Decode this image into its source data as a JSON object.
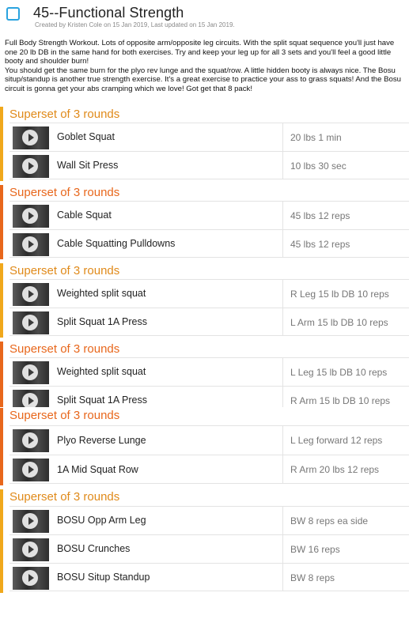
{
  "header": {
    "title": "45--Functional Strength",
    "meta": "Created by Kristen Cole on 15 Jan 2019, Last updated on 15 Jan 2019."
  },
  "description": [
    "Full Body Strength Workout. Lots of opposite arm/opposite leg circuits. With the split squat sequence you'll just have one 20 lb DB in the same hand for both exercises. Try and keep your leg up for all 3 sets and you'll feel a good little booty and shoulder burn!",
    "You should get the same burn for the plyo rev lunge and the squat/row. A little hidden booty is always nice. The Bosu situp/standup is another true strength exercise. It's a great exercise to practice your ass to grass squats! And the Bosu circuit is gonna get your abs cramping which we love! Got get that 8 pack!"
  ],
  "colors": {
    "accent_orange": "#e8671c",
    "accent_yellow": "#f0a81c",
    "checkbox_blue": "#2aa3df"
  },
  "sections": [
    {
      "title": "Superset of 3 rounds",
      "exercises": [
        {
          "name": "Goblet Squat",
          "detail": "20 lbs 1 min"
        },
        {
          "name": "Wall Sit Press",
          "detail": "10 lbs 30 sec"
        }
      ]
    },
    {
      "title": "Superset of 3 rounds",
      "exercises": [
        {
          "name": "Cable Squat",
          "detail": "45 lbs 12 reps"
        },
        {
          "name": "Cable Squatting Pulldowns",
          "detail": "45 lbs 12 reps"
        }
      ]
    },
    {
      "title": "Superset of 3 rounds",
      "exercises": [
        {
          "name": "Weighted split squat",
          "detail": "R Leg 15 lb DB 10 reps"
        },
        {
          "name": "Split Squat 1A Press",
          "detail": "L Arm 15 lb DB 10 reps"
        }
      ]
    },
    {
      "title": "Superset of 3 rounds",
      "exercises": [
        {
          "name": "Weighted split squat",
          "detail": "L Leg 15 lb DB 10 reps"
        },
        {
          "name": "Split Squat 1A Press",
          "detail": "R Arm 15 lb DB 10 reps"
        }
      ]
    },
    {
      "title": "Superset of 3 rounds",
      "exercises": [
        {
          "name": "Plyo Reverse Lunge",
          "detail": "L Leg forward 12 reps"
        },
        {
          "name": "1A Mid Squat Row",
          "detail": "R Arm 20 lbs 12 reps"
        }
      ]
    },
    {
      "title": "Superset of 3 rounds",
      "exercises": [
        {
          "name": "BOSU Opp Arm Leg",
          "detail": "BW 8 reps ea side"
        },
        {
          "name": "BOSU Crunches",
          "detail": "BW 16 reps"
        },
        {
          "name": "BOSU Situp Standup",
          "detail": "BW 8 reps"
        }
      ]
    }
  ]
}
